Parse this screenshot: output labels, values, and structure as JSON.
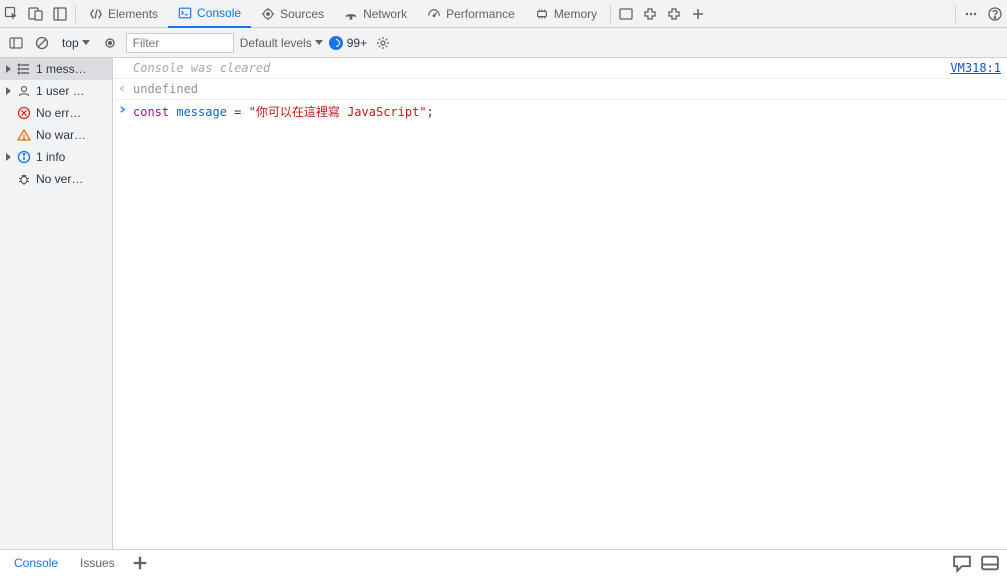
{
  "tabs": {
    "elements": "Elements",
    "console": "Console",
    "sources": "Sources",
    "network": "Network",
    "performance": "Performance",
    "memory": "Memory"
  },
  "filter": {
    "context": "top",
    "placeholder": "Filter",
    "levels": "Default levels",
    "issues_count": "99+"
  },
  "sidebar": {
    "messages": "1 mess…",
    "user": "1 user …",
    "no_err": "No err…",
    "no_war": "No war…",
    "info": "1 info",
    "no_ver": "No ver…"
  },
  "console": {
    "cleared": "Console was cleared",
    "source_link": "VM318:1",
    "undefined_text": "undefined",
    "code_kw": "const",
    "code_ident": "message",
    "code_eq": " = ",
    "code_str": "\"你可以在這裡寫 JavaScript\"",
    "code_semi": ";"
  },
  "status": {
    "console": "Console",
    "issues": "Issues"
  }
}
